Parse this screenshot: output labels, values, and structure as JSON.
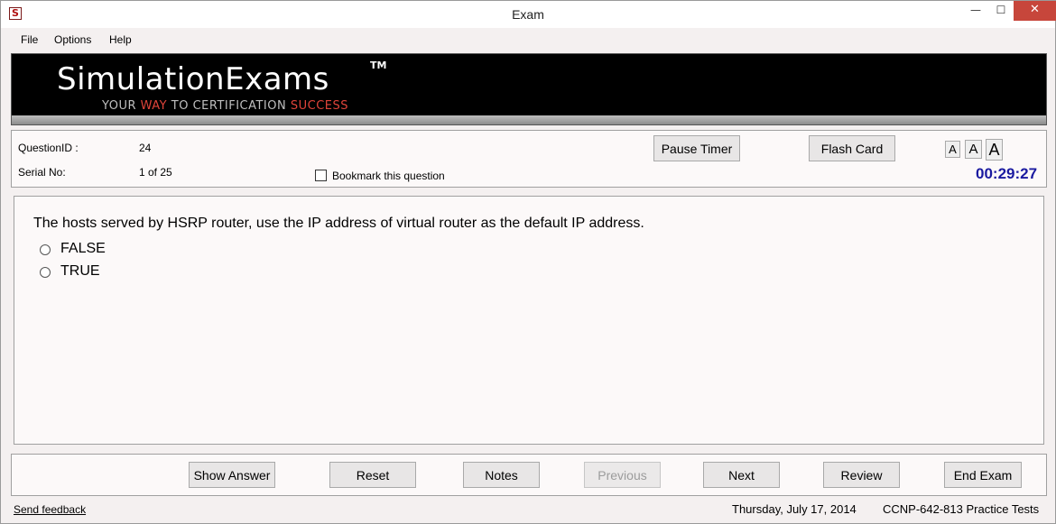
{
  "window": {
    "title": "Exam",
    "app_icon_glyph": "S",
    "minimize_glyph": "—",
    "maximize_glyph": "☐",
    "close_glyph": "✕"
  },
  "menu": {
    "items": [
      "File",
      "Options",
      "Help"
    ]
  },
  "banner": {
    "brand": "SimulationExams",
    "tm": "TM",
    "tagline_parts": [
      "YOUR ",
      "WAY",
      " TO CERTIFICATION ",
      "SUCCESS"
    ]
  },
  "info": {
    "question_id_label": "QuestionID :",
    "question_id_value": "24",
    "serial_label": "Serial No:",
    "serial_value": "1 of 25",
    "bookmark_label": "Bookmark this question",
    "bookmark_checked": false,
    "pause_timer_label": "Pause Timer",
    "flash_card_label": "Flash Card",
    "font_sizes": [
      "A",
      "A",
      "A"
    ],
    "timer": "00:29:27"
  },
  "question": {
    "text": "The hosts served by HSRP router, use the IP address of virtual router as the default IP address.",
    "options": [
      "FALSE",
      "TRUE"
    ]
  },
  "actions": {
    "show_answer": "Show Answer",
    "reset": "Reset",
    "notes": "Notes",
    "previous": "Previous",
    "next": "Next",
    "review": "Review",
    "end_exam": "End Exam"
  },
  "status": {
    "feedback": "Send feedback",
    "date": "Thursday, July 17, 2014",
    "product": "CCNP-642-813 Practice Tests"
  },
  "colors": {
    "timer": "#1a1aa0",
    "close_button": "#c7463b",
    "tagline_accent": "#e0443a"
  }
}
